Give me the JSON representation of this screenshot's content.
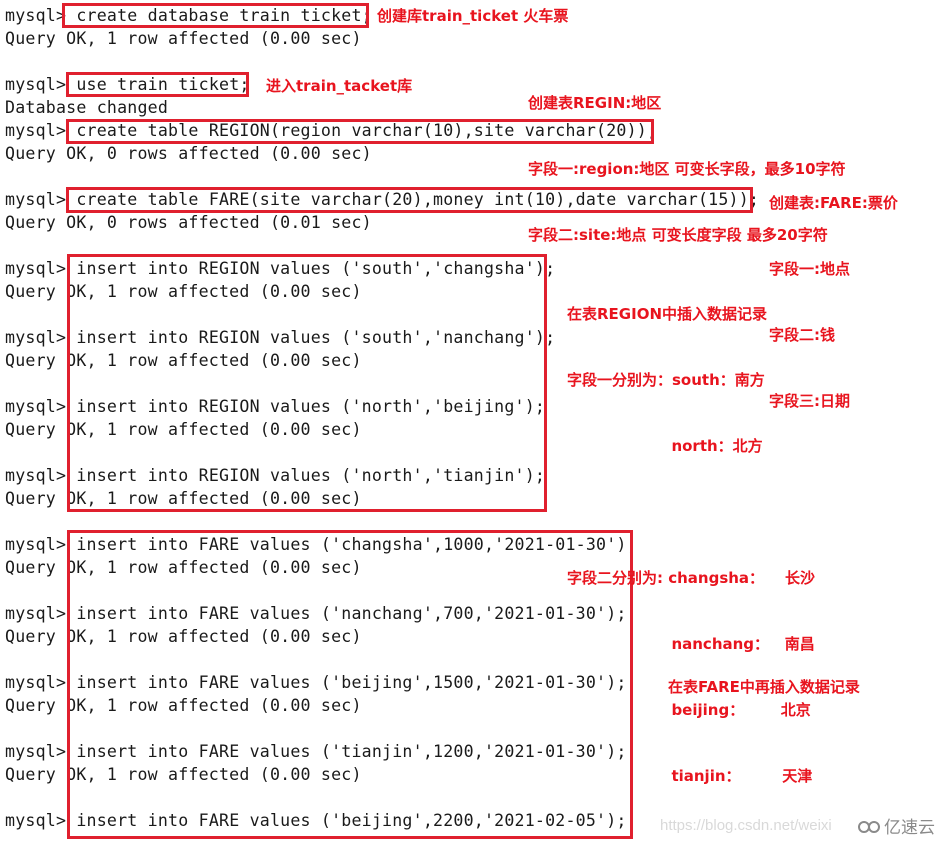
{
  "terminal": {
    "prompt": "mysql> ",
    "lines": [
      {
        "type": "cmd",
        "text": "create database train ticket;"
      },
      {
        "type": "out",
        "text": "Query OK, 1 row affected (0.00 sec)"
      },
      {
        "type": "cmd",
        "text": "use train ticket;"
      },
      {
        "type": "out",
        "text": "Database changed"
      },
      {
        "type": "cmd",
        "text": "create table REGION(region varchar(10),site varchar(20));"
      },
      {
        "type": "out",
        "text": "Query OK, 0 rows affected (0.00 sec)"
      },
      {
        "type": "cmd",
        "text": "create table FARE(site varchar(20),money int(10),date varchar(15));"
      },
      {
        "type": "out",
        "text": "Query OK, 0 rows affected (0.01 sec)"
      },
      {
        "type": "cmd",
        "text": "insert into REGION values ('south','changsha');"
      },
      {
        "type": "out",
        "text": "Query OK, 1 row affected (0.00 sec)"
      },
      {
        "type": "cmd",
        "text": "insert into REGION values ('south','nanchang');"
      },
      {
        "type": "out",
        "text": "Query OK, 1 row affected (0.00 sec)"
      },
      {
        "type": "cmd",
        "text": "insert into REGION values ('north','beijing');"
      },
      {
        "type": "out",
        "text": "Query OK, 1 row affected (0.00 sec)"
      },
      {
        "type": "cmd",
        "text": "insert into REGION values ('north','tianjin');"
      },
      {
        "type": "out",
        "text": "Query OK, 1 row affected (0.00 sec)"
      },
      {
        "type": "cmd",
        "text": "insert into FARE values ('changsha',1000,'2021-01-30');"
      },
      {
        "type": "out",
        "text": "Query OK, 1 row affected (0.00 sec)"
      },
      {
        "type": "cmd",
        "text": "insert into FARE values ('nanchang',700,'2021-01-30');"
      },
      {
        "type": "out",
        "text": "Query OK, 1 row affected (0.00 sec)"
      },
      {
        "type": "cmd",
        "text": "insert into FARE values ('beijing',1500,'2021-01-30');"
      },
      {
        "type": "out",
        "text": "Query OK, 1 row affected (0.00 sec)"
      },
      {
        "type": "cmd",
        "text": "insert into FARE values ('tianjin',1200,'2021-01-30');"
      },
      {
        "type": "out",
        "text": "Query OK, 1 row affected (0.00 sec)"
      },
      {
        "type": "cmd",
        "text": "insert into FARE values ('beijing',2200,'2021-02-05');"
      }
    ]
  },
  "annotations": {
    "create_db": "创建库train_ticket 火车票",
    "use_db": "进入train_tacket库",
    "region_table": [
      "创建表REGIN:地区",
      "字段一:region:地区 可变长字段，最多10字符",
      "字段二:site:地点 可变长度字段 最多20字符"
    ],
    "fare_table": [
      "创建表:FARE:票价",
      "字段一:地点",
      "字段二:钱",
      "字段三:日期"
    ],
    "region_insert": [
      "在表REGION中插入数据记录",
      "字段一分别为：south：南方",
      "                    north：北方",
      "",
      "字段二分别为: changsha：    长沙",
      "                    nanchang：   南昌",
      "                    beijing：       北京",
      "                    tianjin：        天津"
    ],
    "fare_insert": "在表FARE中再插入数据记录"
  },
  "colors": {
    "highlight": "#e0202e",
    "annotation": "#e8141e"
  },
  "watermark": {
    "text": "https://blog.csdn.net/weixi",
    "brand": "亿速云",
    "brand_icon": "cloud-logo-icon"
  }
}
